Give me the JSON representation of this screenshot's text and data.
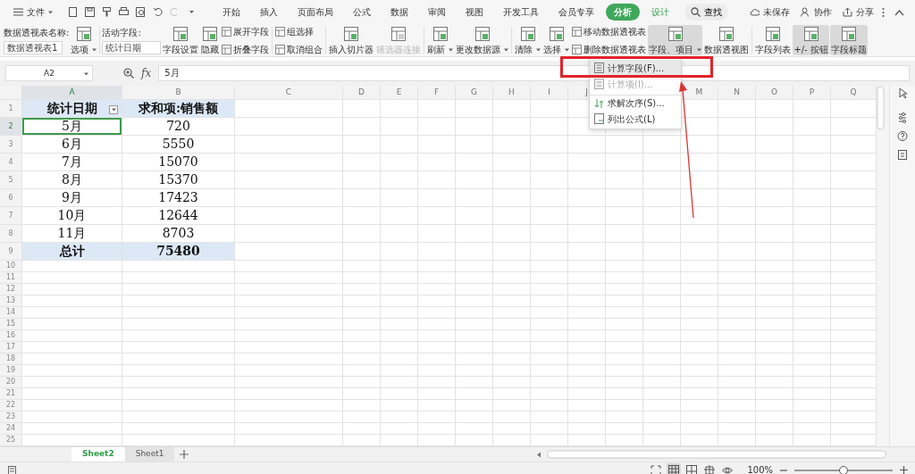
{
  "menu_bar": {
    "file_menu": "文件",
    "tabs": [
      {
        "label": "开始",
        "selected": false,
        "contextual": false
      },
      {
        "label": "插入",
        "selected": false,
        "contextual": false
      },
      {
        "label": "页面布局",
        "selected": false,
        "contextual": false
      },
      {
        "label": "公式",
        "selected": false,
        "contextual": false
      },
      {
        "label": "数据",
        "selected": false,
        "contextual": false
      },
      {
        "label": "审阅",
        "selected": false,
        "contextual": false
      },
      {
        "label": "视图",
        "selected": false,
        "contextual": false
      },
      {
        "label": "开发工具",
        "selected": false,
        "contextual": false
      },
      {
        "label": "会员专享",
        "selected": false,
        "contextual": false
      },
      {
        "label": "分析",
        "selected": true,
        "contextual": true
      },
      {
        "label": "设计",
        "selected": false,
        "contextual": true
      }
    ],
    "search": "查找",
    "actions": [
      "未保存",
      "协作",
      "分享"
    ]
  },
  "ribbon": [
    {
      "kind": "field",
      "label": "数据透视表名称:",
      "value": "数据透视表1"
    },
    {
      "kind": "large",
      "label": "选项",
      "dropdown": true,
      "disabled": false,
      "pressed": false
    },
    {
      "kind": "divider"
    },
    {
      "kind": "field",
      "label": "活动字段:",
      "value": "统计日期"
    },
    {
      "kind": "large",
      "label": "字段设置",
      "dropdown": false,
      "disabled": false,
      "pressed": false
    },
    {
      "kind": "large",
      "label": "隐藏",
      "dropdown": false,
      "disabled": false,
      "pressed": false
    },
    {
      "kind": "stack",
      "buttons": [
        {
          "label": "展开字段"
        },
        {
          "label": "折叠字段"
        }
      ]
    },
    {
      "kind": "divider"
    },
    {
      "kind": "stack",
      "buttons": [
        {
          "label": "组选择"
        },
        {
          "label": "取消组合"
        }
      ]
    },
    {
      "kind": "divider"
    },
    {
      "kind": "large",
      "label": "插入切片器",
      "dropdown": false,
      "disabled": false,
      "pressed": false
    },
    {
      "kind": "large",
      "label": "筛选器连接",
      "dropdown": false,
      "disabled": true,
      "pressed": false
    },
    {
      "kind": "divider"
    },
    {
      "kind": "large",
      "label": "刷新",
      "dropdown": true,
      "disabled": false,
      "pressed": false
    },
    {
      "kind": "large",
      "label": "更改数据源",
      "dropdown": true,
      "disabled": false,
      "pressed": false
    },
    {
      "kind": "divider"
    },
    {
      "kind": "large",
      "label": "清除",
      "dropdown": true,
      "disabled": false,
      "pressed": false
    },
    {
      "kind": "large",
      "label": "选择",
      "dropdown": true,
      "disabled": false,
      "pressed": false
    },
    {
      "kind": "stack",
      "buttons": [
        {
          "label": "移动数据透视表"
        },
        {
          "label": "删除数据透视表"
        }
      ]
    },
    {
      "kind": "large",
      "label": "字段、项目",
      "dropdown": true,
      "disabled": false,
      "pressed": true
    },
    {
      "kind": "large",
      "label": "数据透视图",
      "dropdown": false,
      "disabled": false,
      "pressed": false
    },
    {
      "kind": "divider"
    },
    {
      "kind": "large",
      "label": "字段列表",
      "dropdown": false,
      "disabled": false,
      "pressed": false
    },
    {
      "kind": "large",
      "label": "+/- 按钮",
      "dropdown": false,
      "disabled": false,
      "pressed": true
    },
    {
      "kind": "large",
      "label": "字段标题",
      "dropdown": false,
      "disabled": false,
      "pressed": true
    }
  ],
  "dropdown_menu": [
    {
      "label": "计算字段(F)...",
      "highlighted": true,
      "disabled": false,
      "separator_before": false
    },
    {
      "label": "计算项(I)...",
      "highlighted": false,
      "disabled": true,
      "separator_before": false
    },
    {
      "label": "求解次序(S)...",
      "highlighted": false,
      "disabled": false,
      "separator_before": true
    },
    {
      "label": "列出公式(L)",
      "highlighted": false,
      "disabled": false,
      "separator_before": false
    }
  ],
  "formula_bar": {
    "name_box": "A2",
    "function_label": "fx",
    "formula": "5月"
  },
  "sheet": {
    "columns_left": [
      "A",
      "B",
      "C",
      "D",
      "E",
      "F",
      "G",
      "H",
      "I",
      "J"
    ],
    "columns_right": [
      "M",
      "N",
      "O",
      "P",
      "Q"
    ],
    "row_numbers": [
      "1",
      "2",
      "3",
      "4",
      "5",
      "6",
      "7",
      "8",
      "9",
      "10",
      "11",
      "12",
      "13",
      "14",
      "15",
      "16",
      "17",
      "18",
      "19",
      "20",
      "21",
      "22",
      "23",
      "24",
      "25"
    ],
    "pivot": {
      "headers": [
        {
          "label": "统计日期",
          "filter": true
        },
        {
          "label": "求和项:销售额",
          "filter": false
        }
      ],
      "rows": [
        {
          "date": "5月",
          "value": "720",
          "selected": true
        },
        {
          "date": "6月",
          "value": "5550",
          "selected": false
        },
        {
          "date": "7月",
          "value": "15070",
          "selected": false
        },
        {
          "date": "8月",
          "value": "15370",
          "selected": false
        },
        {
          "date": "9月",
          "value": "17423",
          "selected": false
        },
        {
          "date": "10月",
          "value": "12644",
          "selected": false
        },
        {
          "date": "11月",
          "value": "8703",
          "selected": false
        }
      ],
      "total": {
        "label": "总计",
        "value": "75480"
      }
    }
  },
  "sheet_tabs": [
    {
      "label": "Sheet2",
      "selected": true
    },
    {
      "label": "Sheet1",
      "selected": false
    }
  ],
  "status_bar": {
    "zoom": "100%",
    "zoom_slider": {
      "level": 0.5
    }
  }
}
